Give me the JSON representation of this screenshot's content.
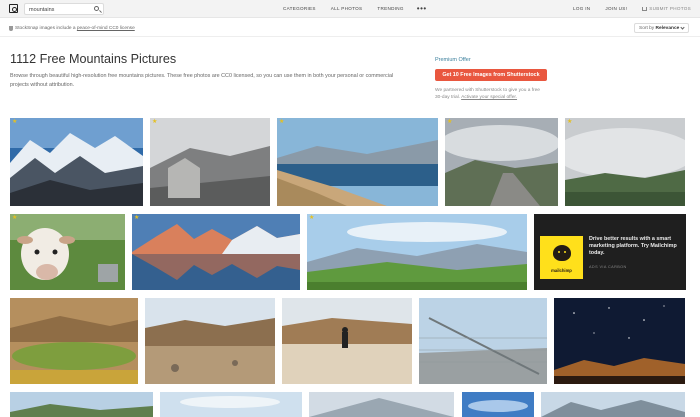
{
  "nav": {
    "search_value": "mountains",
    "links": [
      "CATEGORIES",
      "ALL PHOTOS",
      "TRENDING"
    ],
    "more": "•••",
    "login": "LOG IN",
    "join": "JOIN US!",
    "submit": "SUBMIT PHOTOS"
  },
  "subbar": {
    "license_prefix": "StockSnap images include a",
    "license_link": "peace-of-mind CC0 license",
    "sort_prefix": "Sort by",
    "sort_value": "Relevance"
  },
  "header": {
    "title": "1112 Free Mountains Pictures",
    "description": "Browse through beautiful high-resolution free mountains pictures. These free photos are CC0 licensed, so you can use them in both your personal or commercial projects without attribution."
  },
  "offer": {
    "label": "Premium Offer",
    "button": "Get 10 Free Images from Shutterstock",
    "desc_prefix": "We partnered with Shutterstock to give you a free 30-day trial.",
    "desc_link": "Activate your special offer."
  },
  "ad": {
    "logo_text": "mailchimp",
    "text": "Drive better results with a smart marketing platform. Try Mailchimp today.",
    "via": "ADS VIA CARBON"
  },
  "colors": {
    "accent": "#e9573f",
    "premium": "#3b7f9c",
    "star": "#e5c020",
    "ad_bg": "#1f1f1f",
    "mailchimp": "#ffe01b"
  }
}
